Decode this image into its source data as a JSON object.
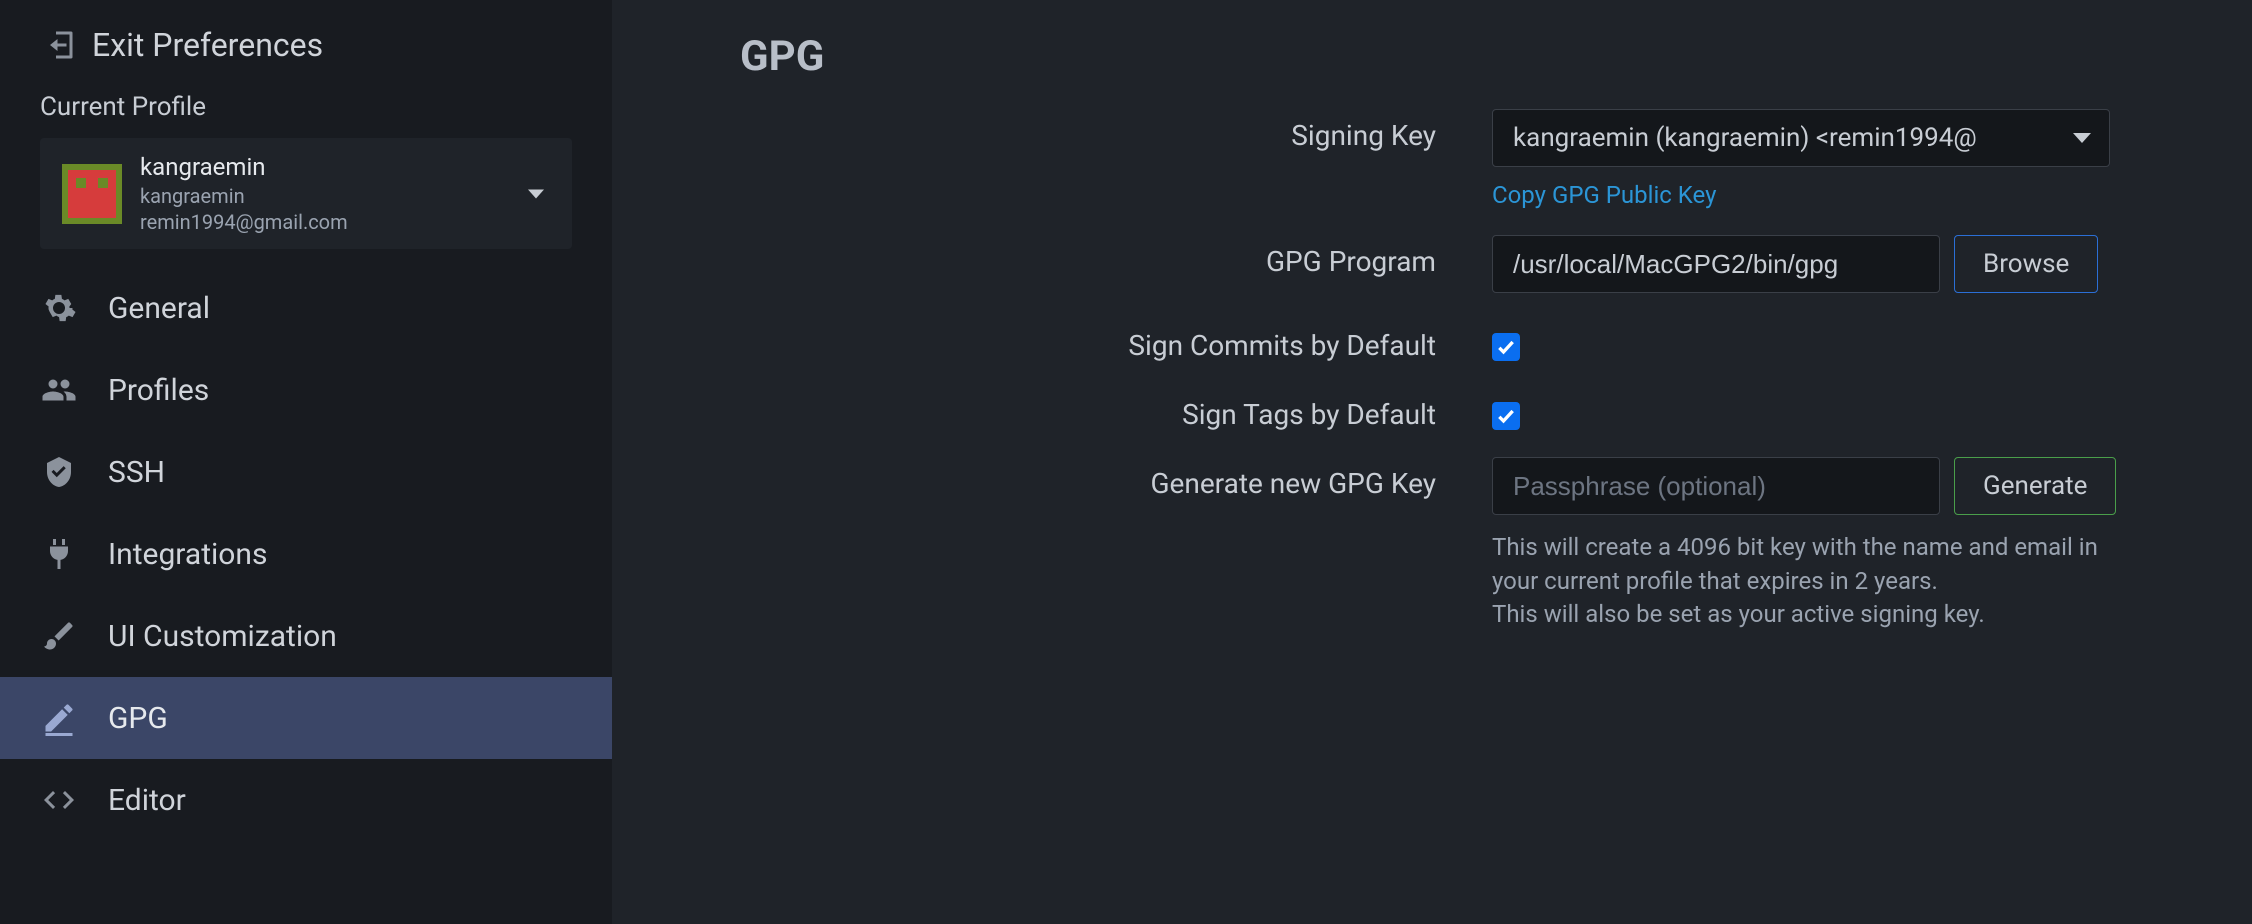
{
  "sidebar": {
    "exit_label": "Exit Preferences",
    "profile_section_label": "Current Profile",
    "profile": {
      "name": "kangraemin",
      "username": "kangraemin",
      "email": "remin1994@gmail.com"
    },
    "nav": [
      {
        "label": "General"
      },
      {
        "label": "Profiles"
      },
      {
        "label": "SSH"
      },
      {
        "label": "Integrations"
      },
      {
        "label": "UI Customization"
      },
      {
        "label": "GPG"
      },
      {
        "label": "Editor"
      }
    ]
  },
  "main": {
    "title": "GPG",
    "signing_key": {
      "label": "Signing Key",
      "value": "kangraemin (kangraemin) <remin1994@",
      "copy_link": "Copy GPG Public Key"
    },
    "gpg_program": {
      "label": "GPG Program",
      "value": "/usr/local/MacGPG2/bin/gpg",
      "browse_label": "Browse"
    },
    "sign_commits": {
      "label": "Sign Commits by Default",
      "checked": true
    },
    "sign_tags": {
      "label": "Sign Tags by Default",
      "checked": true
    },
    "generate": {
      "label": "Generate new GPG Key",
      "placeholder": "Passphrase (optional)",
      "button_label": "Generate",
      "hint_line1": "This will create a 4096 bit key with the name and email in your current profile that expires in 2 years.",
      "hint_line2": "This will also be set as your active signing key."
    }
  }
}
